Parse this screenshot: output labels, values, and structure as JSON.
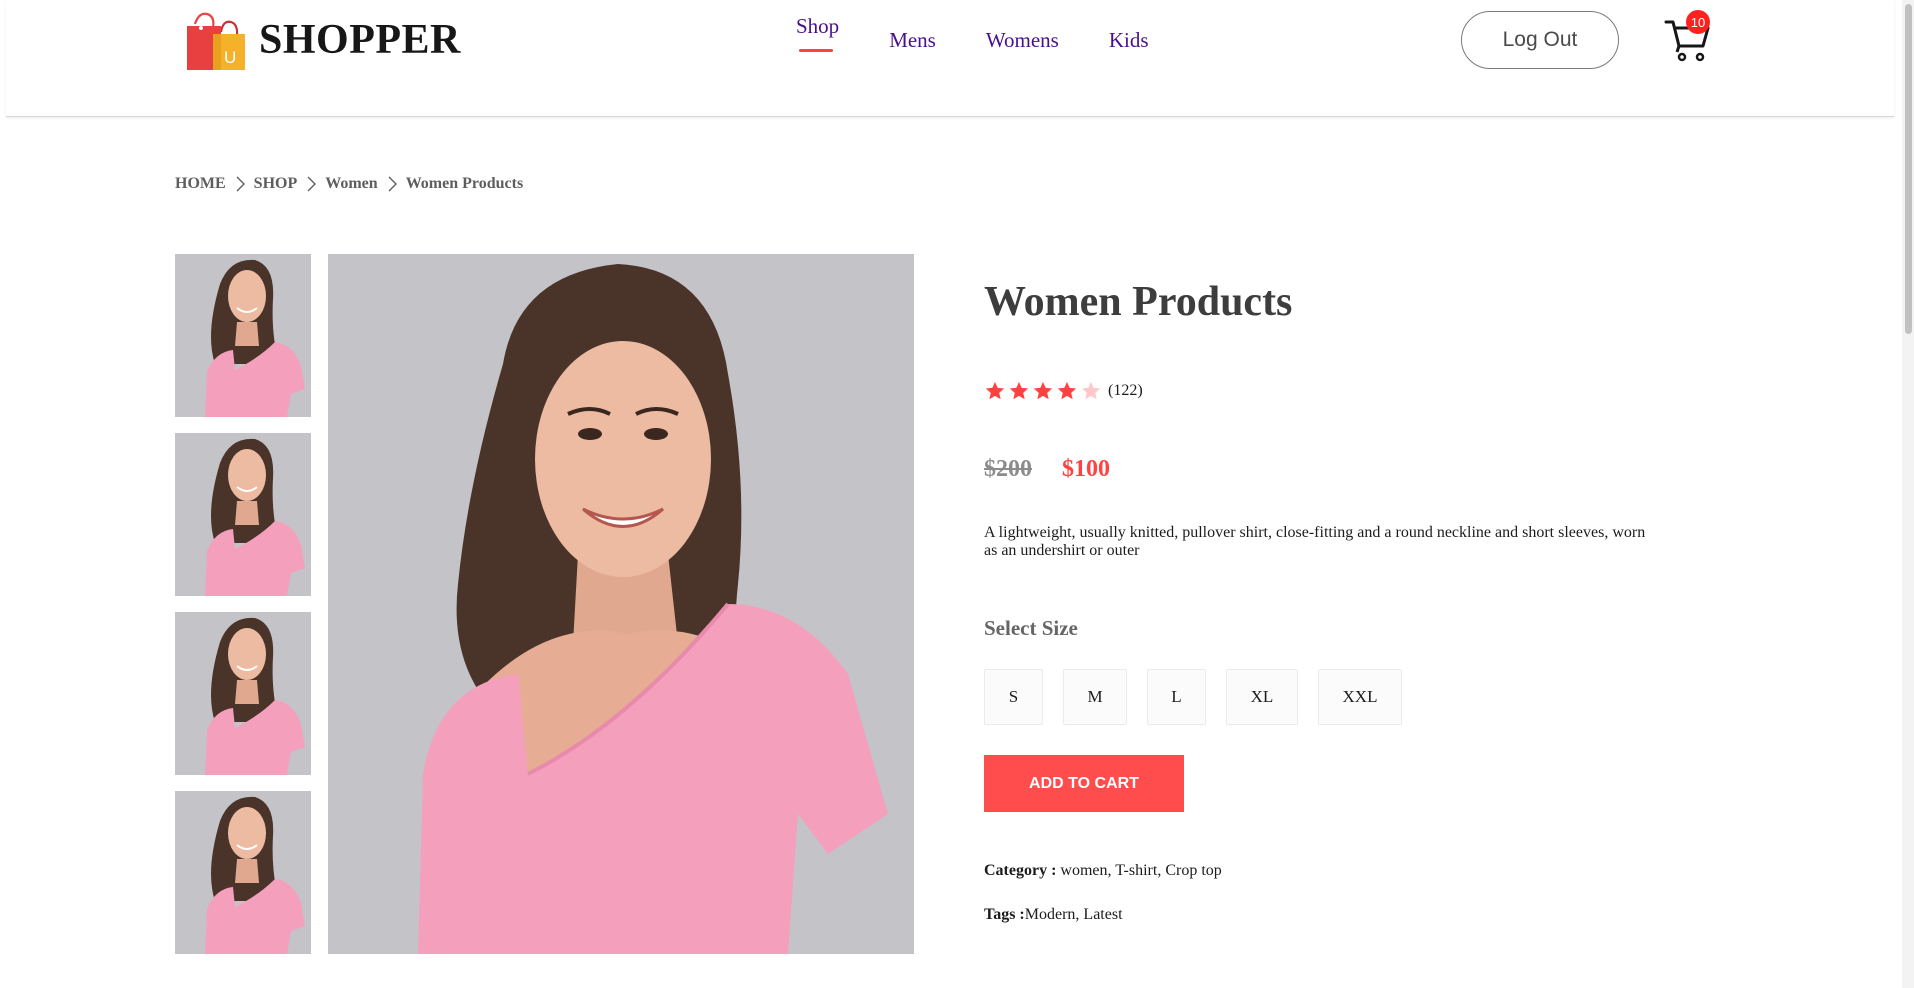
{
  "brand": {
    "name": "SHOPPER",
    "logo_letter": "U"
  },
  "nav": {
    "items": [
      {
        "label": "Shop",
        "active": true
      },
      {
        "label": "Mens",
        "active": false
      },
      {
        "label": "Womens",
        "active": false
      },
      {
        "label": "Kids",
        "active": false
      }
    ],
    "logout_label": "Log Out",
    "cart_count": "10"
  },
  "breadcrumb": [
    "HOME",
    "SHOP",
    "Women",
    "Women Products"
  ],
  "product": {
    "title": "Women Products",
    "rating": 4,
    "rating_max": 5,
    "review_count": "(122)",
    "old_price": "$200",
    "new_price": "$100",
    "description": "A lightweight, usually knitted, pullover shirt, close-fitting and a round neckline and short sleeves, worn as an undershirt or outer",
    "size_label": "Select Size",
    "sizes": [
      "S",
      "M",
      "L",
      "XL",
      "XXL"
    ],
    "add_to_cart_label": "ADD TO CART",
    "category_label": "Category :",
    "category_value": "women, T-shirt, Crop top",
    "tags_label": "Tags :",
    "tags_value": "Modern, Latest",
    "thumbnail_count": 4
  },
  "colors": {
    "accent": "#ff4141",
    "nav_link": "#4a0f8f",
    "shirt_pink": "#f4a0bd",
    "photo_bg": "#c4c3c8",
    "star_filled": "#ff4141",
    "star_empty": "#ffc7c7"
  },
  "icons": {
    "logo": "shopping-bag-icon",
    "cart": "shopping-cart-icon",
    "breadcrumb_sep": "chevron-right-icon",
    "star": "star-icon"
  }
}
